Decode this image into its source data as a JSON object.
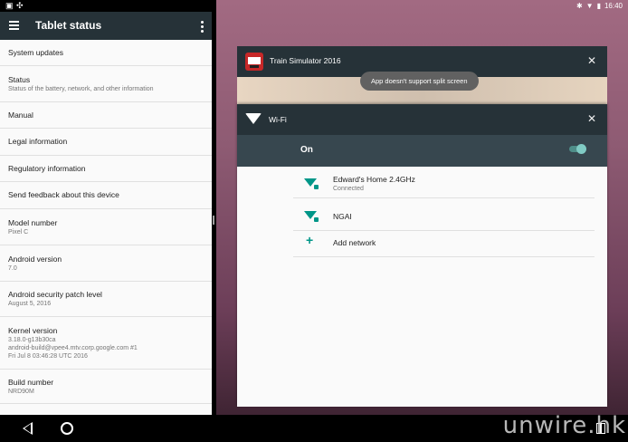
{
  "left": {
    "title": "Tablet status",
    "rows": [
      {
        "title": "System updates",
        "sub": ""
      },
      {
        "title": "Status",
        "sub": "Status of the battery, network, and other information"
      },
      {
        "title": "Manual",
        "sub": ""
      },
      {
        "title": "Legal information",
        "sub": ""
      },
      {
        "title": "Regulatory information",
        "sub": ""
      },
      {
        "title": "Send feedback about this device",
        "sub": ""
      },
      {
        "title": "Model number",
        "sub": "Pixel C"
      },
      {
        "title": "Android version",
        "sub": "7.0"
      },
      {
        "title": "Android security patch level",
        "sub": "August 5, 2016"
      },
      {
        "title": "Kernel version",
        "sub": "3.18.0-g13b30ca",
        "sub2": "android-build@vpee4.mtv.corp.google.com #1",
        "sub3": "Fri Jul 8 03:46:28 UTC 2016"
      },
      {
        "title": "Build number",
        "sub": "NRD90M"
      }
    ]
  },
  "status_right": {
    "time": "16:40"
  },
  "recents": {
    "app_card": {
      "title": "Train Simulator 2016"
    },
    "toast": "App doesn't support split screen",
    "wifi_card": {
      "title": "Wi-Fi",
      "switch_label": "On",
      "networks": [
        {
          "name": "Edward's Home 2.4GHz",
          "status": "Connected"
        },
        {
          "name": "NGAI",
          "status": ""
        }
      ],
      "add_network": "Add network"
    }
  },
  "watermark": "unwire.hk",
  "colors": {
    "toolbar": "#263238",
    "accent": "#009688"
  }
}
